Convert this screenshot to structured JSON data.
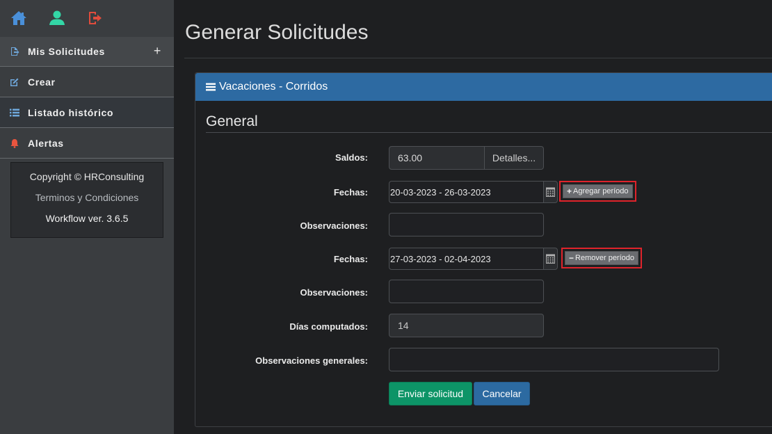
{
  "sidebar": {
    "top_icons": [
      {
        "icon": "home-icon",
        "color": "#4a90d9"
      },
      {
        "icon": "user-icon",
        "color": "#33d6a6"
      },
      {
        "icon": "logout-icon",
        "color": "#e04c3c"
      }
    ],
    "items": [
      {
        "label": "Mis Solicitudes",
        "icon": "file-export-icon",
        "expander": "+"
      },
      {
        "label": "Crear",
        "icon": "edit-icon"
      },
      {
        "label": "Listado histórico",
        "icon": "list-icon"
      },
      {
        "label": "Alertas",
        "icon": "bell-icon"
      }
    ],
    "footer": {
      "copyright": "Copyright © HRConsulting",
      "terms": "Terminos y Condiciones",
      "version": "Workflow ver. 3.6.5"
    }
  },
  "main": {
    "title": "Generar Solicitudes",
    "panel": {
      "header": "Vacaciones - Corridos",
      "section": "General",
      "saldos": {
        "label": "Saldos:",
        "value": "63.00",
        "details_label": "Detalles..."
      },
      "period1": {
        "label": "Fechas:",
        "value": "20-03-2023 - 26-03-2023",
        "button_icon": "+",
        "button_label": "Agregar período"
      },
      "obs1": {
        "label": "Observaciones:",
        "value": ""
      },
      "period2": {
        "label": "Fechas:",
        "value": "27-03-2023 - 02-04-2023",
        "button_icon": "−",
        "button_label": "Remover período"
      },
      "obs2": {
        "label": "Observaciones:",
        "value": ""
      },
      "dias": {
        "label": "Días computados:",
        "value": "14"
      },
      "obs_general": {
        "label": "Observaciones generales:",
        "value": ""
      },
      "submit_label": "Enviar solicitud",
      "cancel_label": "Cancelar"
    }
  },
  "colors": {
    "header_blue": "#2d6aa2",
    "submit_green": "#0d9467",
    "highlight_red": "#e0232b"
  }
}
